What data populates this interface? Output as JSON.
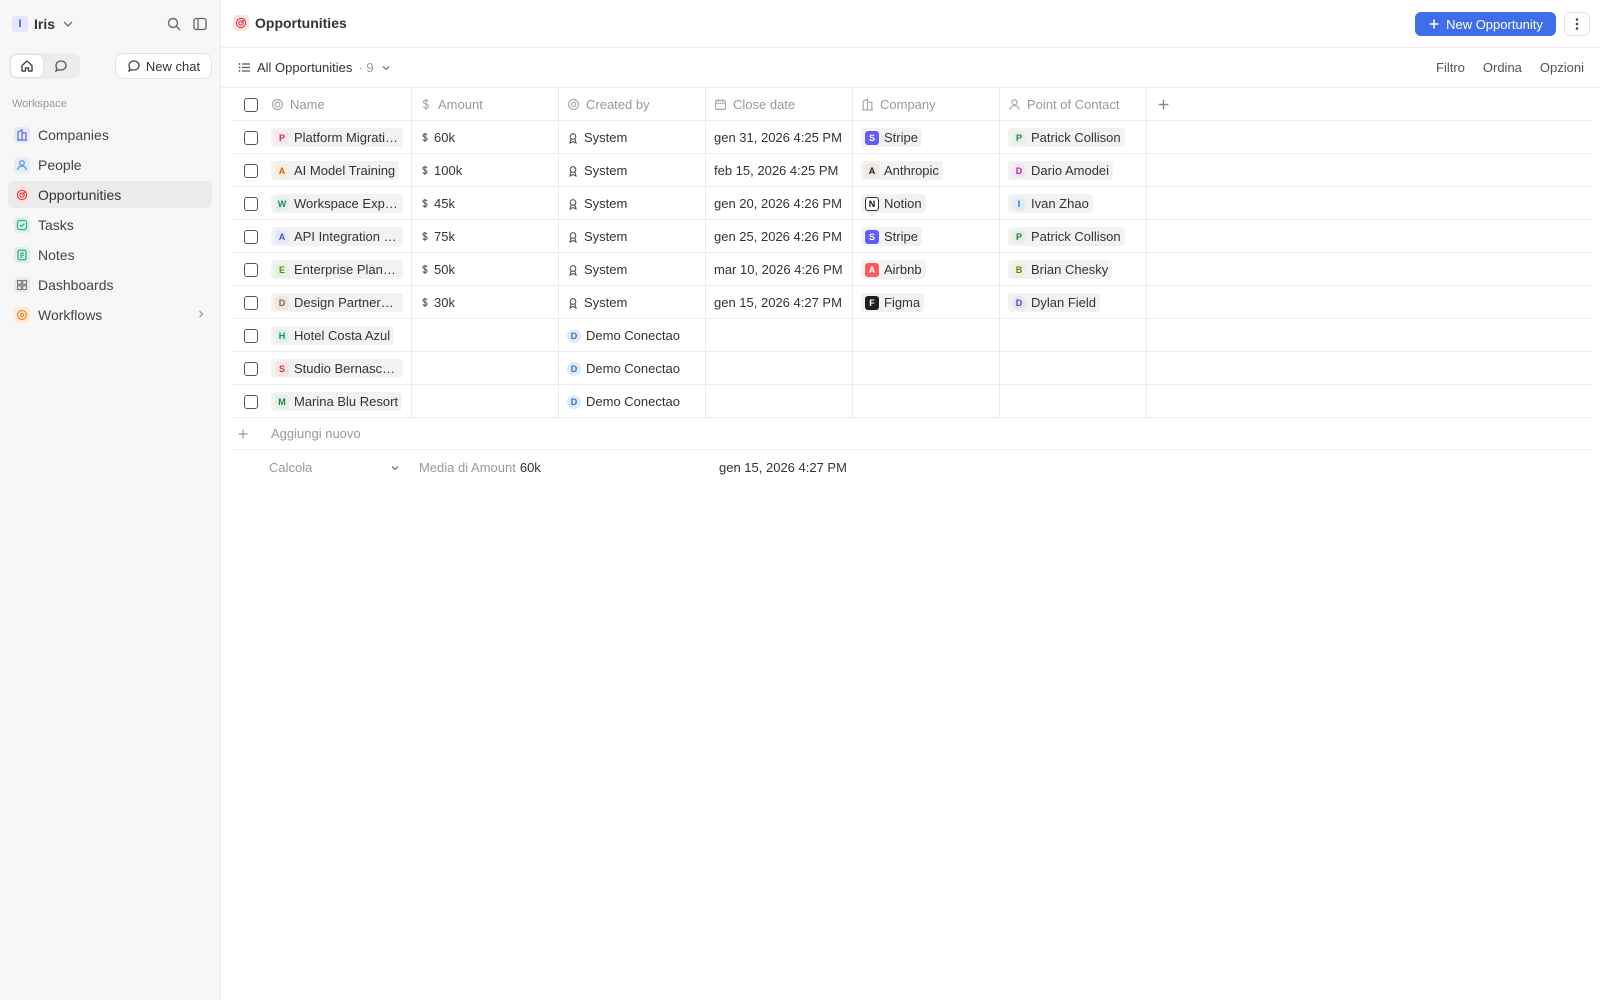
{
  "workspace": {
    "initial": "I",
    "name": "Iris"
  },
  "sidebar": {
    "new_chat_label": "New chat",
    "section_label": "Workspace",
    "items": [
      {
        "label": "Companies",
        "icon": "building-icon",
        "color": "#5b6ee1"
      },
      {
        "label": "People",
        "icon": "user-icon",
        "color": "#4d8fe0"
      },
      {
        "label": "Opportunities",
        "icon": "target-icon",
        "color": "#e3474d"
      },
      {
        "label": "Tasks",
        "icon": "checkbox-icon",
        "color": "#2bb08a"
      },
      {
        "label": "Notes",
        "icon": "note-icon",
        "color": "#2ba87a"
      },
      {
        "label": "Dashboards",
        "icon": "dashboard-icon",
        "color": "#8a8a8a"
      },
      {
        "label": "Workflows",
        "icon": "workflow-icon",
        "color": "#f08a24"
      }
    ]
  },
  "header": {
    "title": "Opportunities",
    "new_button_label": "New Opportunity"
  },
  "view": {
    "name": "All Opportunities",
    "count": "· 9",
    "actions": [
      "Filtro",
      "Ordina",
      "Opzioni"
    ]
  },
  "table": {
    "columns": [
      "Name",
      "Amount",
      "Created by",
      "Close date",
      "Company",
      "Point of Contact"
    ],
    "rows": [
      {
        "initial": "P",
        "name": "Platform Migration",
        "amount": "60k",
        "created_by": "System",
        "close_date": "gen 31, 2026 4:25 PM",
        "company": "Stripe",
        "company_logo": "S",
        "contact_initial": "P",
        "contact": "Patrick Collison"
      },
      {
        "initial": "A",
        "name": "AI Model Training",
        "amount": "100k",
        "created_by": "System",
        "close_date": "feb 15, 2026 4:25 PM",
        "company": "Anthropic",
        "company_logo": "A",
        "contact_initial": "D",
        "contact": "Dario Amodei"
      },
      {
        "initial": "W",
        "name": "Workspace Expan...",
        "amount": "45k",
        "created_by": "System",
        "close_date": "gen 20, 2026 4:26 PM",
        "company": "Notion",
        "company_logo": "N",
        "contact_initial": "I",
        "contact": "Ivan Zhao"
      },
      {
        "initial": "A",
        "name": "API Integration Dea",
        "amount": "75k",
        "created_by": "System",
        "close_date": "gen 25, 2026 4:26 PM",
        "company": "Stripe",
        "company_logo": "S",
        "contact_initial": "P",
        "contact": "Patrick Collison"
      },
      {
        "initial": "E",
        "name": "Enterprise Plan U...",
        "amount": "50k",
        "created_by": "System",
        "close_date": "mar 10, 2026 4:26 PM",
        "company": "Airbnb",
        "company_logo": "A",
        "contact_initial": "B",
        "contact": "Brian Chesky"
      },
      {
        "initial": "D",
        "name": "Design Partnership",
        "amount": "30k",
        "created_by": "System",
        "close_date": "gen 15, 2026 4:27 PM",
        "company": "Figma",
        "company_logo": "F",
        "contact_initial": "D",
        "contact": "Dylan Field"
      },
      {
        "initial": "H",
        "name": "Hotel Costa Azul",
        "amount": "",
        "created_by_initial": "D",
        "created_by": "Demo Conectao",
        "close_date": "",
        "company": "",
        "contact": ""
      },
      {
        "initial": "S",
        "name": "Studio Bernasconi",
        "amount": "",
        "created_by_initial": "D",
        "created_by": "Demo Conectao",
        "close_date": "",
        "company": "",
        "contact": ""
      },
      {
        "initial": "M",
        "name": "Marina Blu Resort",
        "amount": "",
        "created_by_initial": "D",
        "created_by": "Demo Conectao",
        "close_date": "",
        "company": "",
        "contact": ""
      }
    ],
    "add_new_label": "Aggiungi nuovo",
    "calc_label": "Calcola",
    "avg_label": "Media di Amount",
    "avg_value": "60k",
    "close_date_summary": "gen 15, 2026 4:27 PM"
  }
}
